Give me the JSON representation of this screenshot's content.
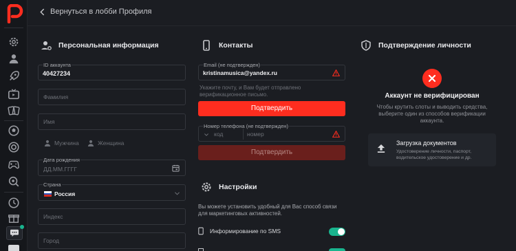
{
  "header": {
    "back_label": "Вернуться в лобби Профиля"
  },
  "personal": {
    "title": "Персональная информация",
    "account_id_label": "ID аккаунта",
    "account_id_value": "40427234",
    "surname_placeholder": "Фамилия",
    "name_placeholder": "Имя",
    "gender_male": "Мужчина",
    "gender_female": "Женщина",
    "birthdate_label": "Дата рождения",
    "birthdate_placeholder": "ДД.ММ.ГГГГ",
    "country_label": "Страна",
    "country_value": "Россия",
    "index_placeholder": "Индекс",
    "city_placeholder": "Город"
  },
  "contacts": {
    "title": "Контакты",
    "email_label": "Email (не подтвержден)",
    "email_value": "kristinamusica@yandex.ru",
    "email_hint_1": "Укажите почту, и Вам будет отправлено",
    "email_hint_2": "верификационное письмо.",
    "confirm_email_label": "Подтвердить",
    "phone_label": "Номер телефона (не подтвержден)",
    "phone_code_placeholder": "код",
    "phone_number_placeholder": "номер",
    "confirm_phone_label": "Подтвердить"
  },
  "settings": {
    "title": "Настройки",
    "description_1": "Вы можете установить удобный для Вас способ связи",
    "description_2": "для маркетинговых активностей.",
    "sms_label": "Информирование по SMS",
    "sms_enabled": true
  },
  "verification": {
    "title": "Подтверждение личности",
    "status": "Аккаунт не верифицирован",
    "desc_1": "Чтобы крутить слоты и выводить средства,",
    "desc_2": "выберите один из способов верификации",
    "desc_3": "аккаунта.",
    "upload_title": "Загрузка документов",
    "upload_desc_1": "Удостоверение личности, паспорт,",
    "upload_desc_2": "водительское удостоверение и др."
  },
  "colors": {
    "accent": "#ff2d1f",
    "toggle_on": "#19b48e",
    "background": "#1b1d22"
  }
}
